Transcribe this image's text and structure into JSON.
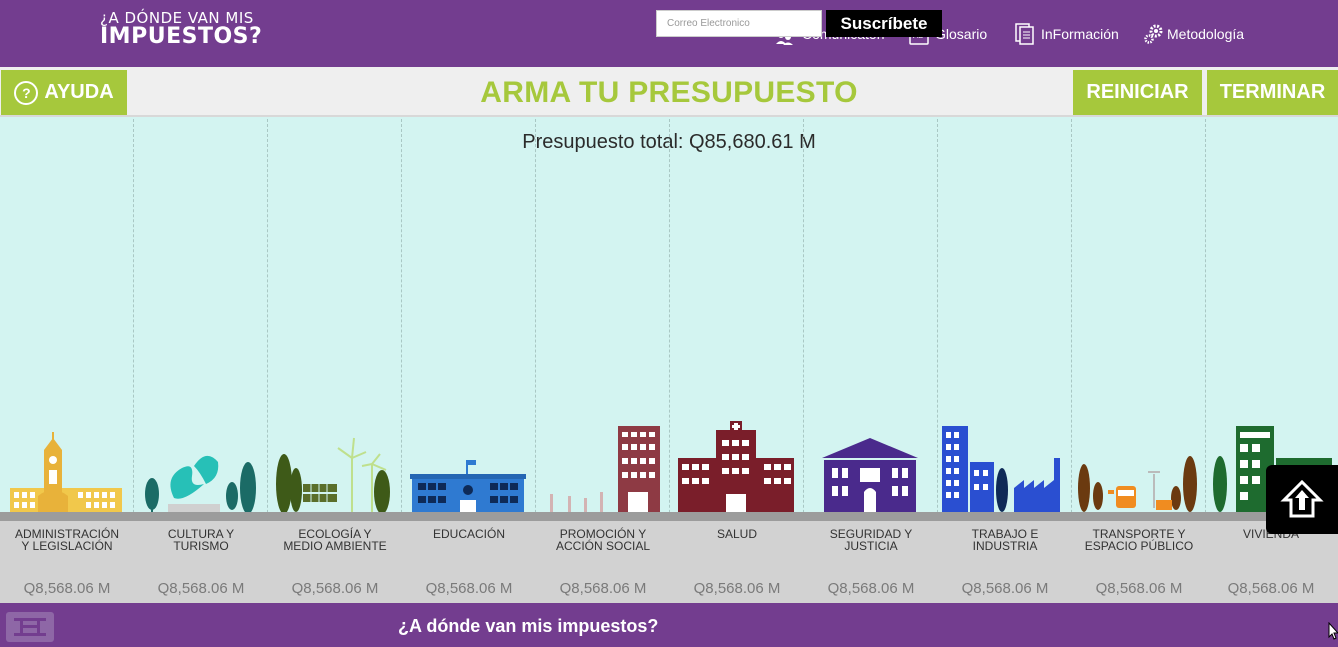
{
  "header": {
    "logo_line1": "¿A DÓNDE VAN MIS",
    "logo_line2": "IMPUESTOS?",
    "nav": [
      {
        "label": "Comunicaton",
        "icon": "people-icon"
      },
      {
        "label": "Glosario",
        "icon": "book-icon"
      },
      {
        "label": "InFormación",
        "icon": "document-icon"
      },
      {
        "label": "Metodología",
        "icon": "gears-icon"
      }
    ]
  },
  "titlebar": {
    "help_label": "AYUDA",
    "help_icon": "?",
    "title": "ARMA TU PRESUPUESTO",
    "reset_label": "REINICIAR",
    "finish_label": "TERMINAR"
  },
  "main": {
    "total": "Presupuesto total: Q85,680.61 M",
    "categories": [
      {
        "line1": "ADMINISTRACIÓN",
        "line2": "Y LEGISLACIÓN",
        "amount": "Q8,568.06 M"
      },
      {
        "line1": "CULTURA Y",
        "line2": "TURISMO",
        "amount": "Q8,568.06 M"
      },
      {
        "line1": "ECOLOGÍA Y",
        "line2": "MEDIO AMBIENTE",
        "amount": "Q8,568.06 M"
      },
      {
        "line1": "EDUCACIÓN",
        "line2": "",
        "amount": "Q8,568.06 M"
      },
      {
        "line1": "PROMOCIÓN Y",
        "line2": "ACCIÓN SOCIAL",
        "amount": "Q8,568.06 M"
      },
      {
        "line1": "SALUD",
        "line2": "",
        "amount": "Q8,568.06 M"
      },
      {
        "line1": "SEGURIDAD Y",
        "line2": "JUSTICIA",
        "amount": "Q8,568.06 M"
      },
      {
        "line1": "TRABAJO E",
        "line2": "INDUSTRIA",
        "amount": "Q8,568.06 M"
      },
      {
        "line1": "TRANSPORTE Y",
        "line2": "ESPACIO PÚBLICO",
        "amount": "Q8,568.06 M"
      },
      {
        "line1": "VIVIENDA",
        "line2": "",
        "amount": "Q8,568.06 M"
      }
    ]
  },
  "footer": {
    "question": "¿A dónde van mis impuestos?",
    "email_placeholder": "Correo Electronico",
    "subscribe_label": "Suscríbete"
  },
  "colors": {
    "purple": "#733d8f",
    "green": "#a6c83c",
    "sky": "#d3f4f1"
  }
}
